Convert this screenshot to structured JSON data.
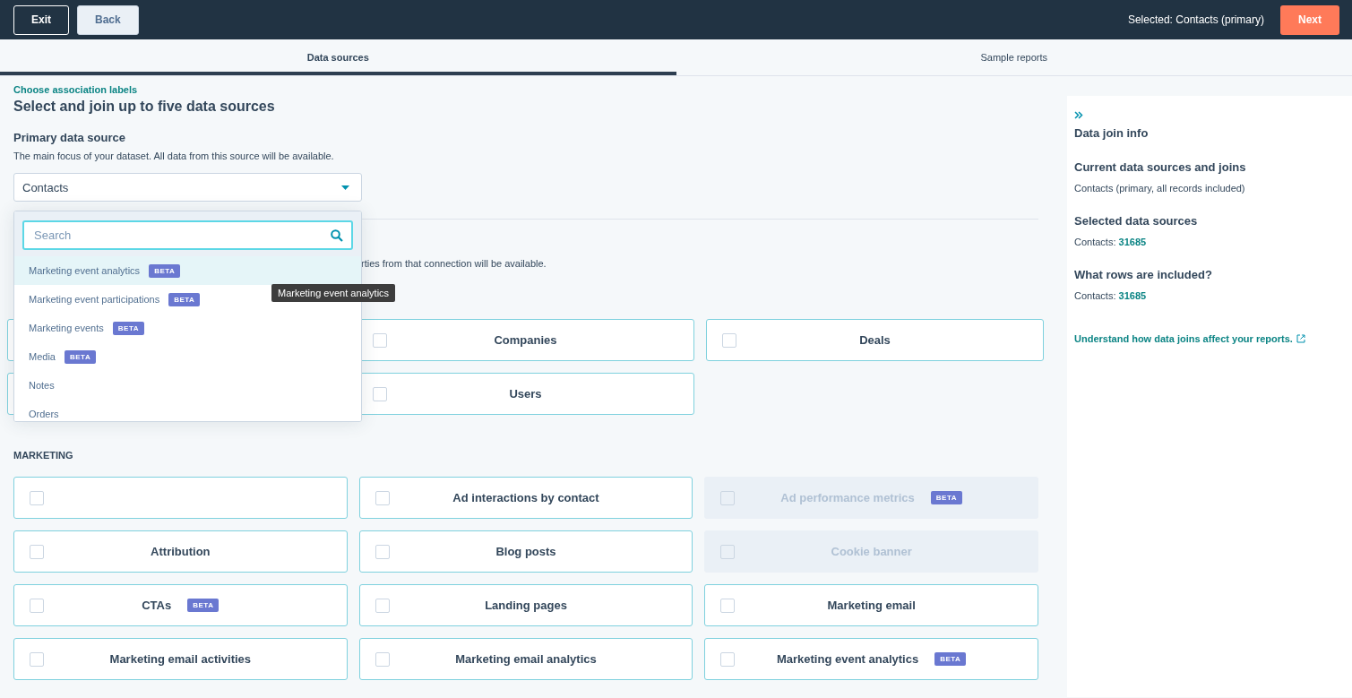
{
  "header": {
    "exit": "Exit",
    "back": "Back",
    "selected_text": "Selected: Contacts (primary)",
    "next": "Next"
  },
  "tabs": [
    {
      "label": "Data sources",
      "selected": true
    },
    {
      "label": "Sample reports",
      "selected": false
    }
  ],
  "main": {
    "link": "Choose association labels",
    "title": "Select and join up to five data sources",
    "primary": {
      "heading": "Primary data source",
      "description": "The main focus of your dataset. All data from this source will be available.",
      "value": "Contacts"
    },
    "dropdown": {
      "placeholder": "Search",
      "items": [
        {
          "label": "Marketing event analytics",
          "badge": "BETA",
          "selected": true
        },
        {
          "label": "Marketing event participations",
          "badge": "BETA",
          "selected": false
        },
        {
          "label": "Marketing events",
          "badge": "BETA",
          "selected": false
        },
        {
          "label": "Media",
          "badge": "BETA",
          "selected": false
        },
        {
          "label": "Notes",
          "selected": false
        },
        {
          "label": "Orders",
          "selected": false
        }
      ]
    },
    "tooltip": "Marketing event analytics",
    "secondary_description": "rties from that connection will be available.",
    "object_cards": [
      {
        "disabled": false
      },
      {
        "label": "Companies",
        "checked": false,
        "disabled": false
      },
      {
        "label": "Deals",
        "checked": false,
        "disabled": false
      },
      {
        "disabled": false
      },
      {
        "label": "Users",
        "checked": false,
        "disabled": false
      }
    ],
    "marketing": {
      "heading": "MARKETING",
      "cards": [
        {
          "checked": false,
          "disabled": false
        },
        {
          "label": "Ad interactions by contact",
          "checked": false,
          "disabled": false
        },
        {
          "label": "Ad performance metrics",
          "badge": "BETA",
          "checked": false,
          "disabled": true
        },
        {
          "label": "Attribution",
          "checked": false,
          "disabled": false
        },
        {
          "label": "Blog posts",
          "checked": false,
          "disabled": false
        },
        {
          "label": "Cookie banner",
          "checked": false,
          "disabled": true
        },
        {
          "label": "CTAs",
          "badge": "BETA",
          "checked": false,
          "disabled": false
        },
        {
          "label": "Landing pages",
          "checked": false,
          "disabled": false
        },
        {
          "label": "Marketing email",
          "checked": false,
          "disabled": false
        },
        {
          "label": "Marketing email activities",
          "checked": false,
          "disabled": false
        },
        {
          "label": "Marketing email analytics",
          "checked": false,
          "disabled": false
        },
        {
          "label": "Marketing event analytics",
          "badge": "BETA",
          "checked": false,
          "disabled": false
        }
      ]
    }
  },
  "side_panel": {
    "title": "Data join info",
    "sections": [
      {
        "heading": "Current data sources and joins",
        "text": "Contacts (primary, all records included)"
      },
      {
        "heading": "Selected data sources",
        "text": "Contacts:",
        "count": "31685"
      },
      {
        "heading": "What rows are included?",
        "text": "Contacts:",
        "count": "31685"
      }
    ],
    "link": "Understand how data joins affect your reports."
  }
}
